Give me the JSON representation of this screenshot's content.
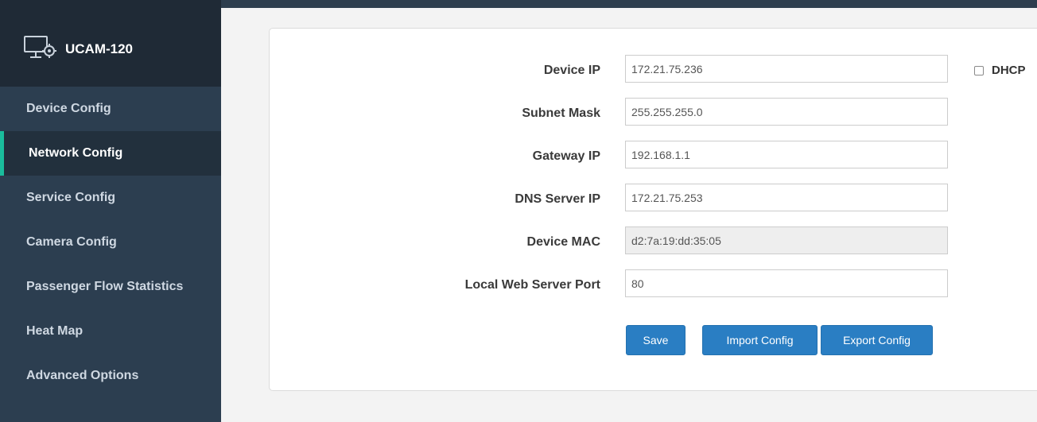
{
  "brand": {
    "title": "UCAM-120",
    "icon": "monitor-gear-icon"
  },
  "sidebar": {
    "items": [
      {
        "label": "Device Config",
        "active": false
      },
      {
        "label": "Network Config",
        "active": true
      },
      {
        "label": "Service Config",
        "active": false
      },
      {
        "label": "Camera Config",
        "active": false
      },
      {
        "label": "Passenger Flow Statistics",
        "active": false
      },
      {
        "label": "Heat Map",
        "active": false
      },
      {
        "label": "Advanced Options",
        "active": false
      }
    ]
  },
  "form": {
    "device_ip": {
      "label": "Device IP",
      "value": "172.21.75.236"
    },
    "subnet_mask": {
      "label": "Subnet Mask",
      "value": "255.255.255.0"
    },
    "gateway_ip": {
      "label": "Gateway IP",
      "value": "192.168.1.1"
    },
    "dns_server_ip": {
      "label": "DNS Server IP",
      "value": "172.21.75.253"
    },
    "device_mac": {
      "label": "Device MAC",
      "value": "d2:7a:19:dd:35:05"
    },
    "web_port": {
      "label": "Local Web Server Port",
      "value": "80"
    },
    "dhcp": {
      "label": "DHCP",
      "checked": false
    }
  },
  "buttons": {
    "save": "Save",
    "import": "Import Config",
    "export": "Export Config"
  },
  "colors": {
    "sidebar_bg": "#2c3e50",
    "brand_bg": "#1f2a36",
    "active_accent": "#1abc9c",
    "button_bg": "#2a7ec3"
  }
}
